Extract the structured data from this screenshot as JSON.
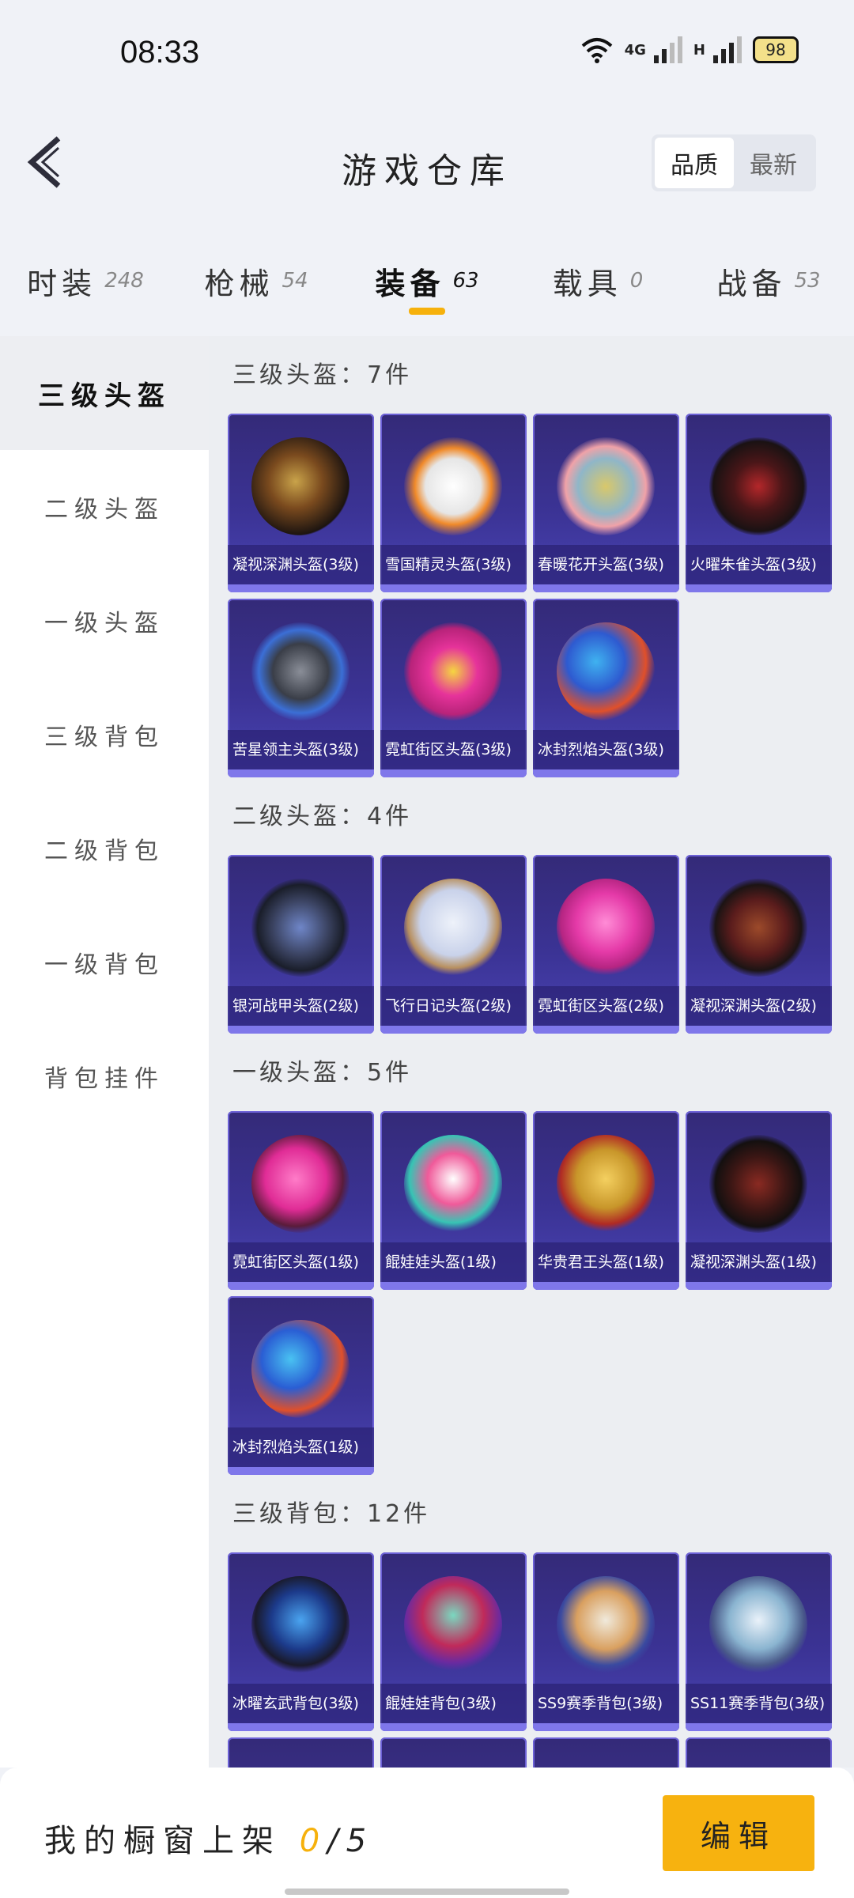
{
  "status": {
    "time": "08:33",
    "network": "4G",
    "network2": "H",
    "battery": "98"
  },
  "header": {
    "title": "游戏仓库",
    "sort_quality": "品质",
    "sort_newest": "最新"
  },
  "tabs": [
    {
      "label": "时装",
      "count": "248"
    },
    {
      "label": "枪械",
      "count": "54"
    },
    {
      "label": "装备",
      "count": "63"
    },
    {
      "label": "载具",
      "count": "0"
    },
    {
      "label": "战备",
      "count": "53"
    }
  ],
  "sidebar": {
    "items": [
      "三级头盔",
      "二级头盔",
      "一级头盔",
      "三级背包",
      "二级背包",
      "一级背包",
      "背包挂件"
    ]
  },
  "sections": [
    {
      "title": "三级头盔：7件",
      "items": [
        "凝视深渊头盔(3级)",
        "雪国精灵头盔(3级)",
        "春暖花开头盔(3级)",
        "火曜朱雀头盔(3级)",
        "苦星领主头盔(3级)",
        "霓虹街区头盔(3级)",
        "冰封烈焰头盔(3级)"
      ]
    },
    {
      "title": "二级头盔：4件",
      "items": [
        "银河战甲头盔(2级)",
        "飞行日记头盔(2级)",
        "霓虹街区头盔(2级)",
        "凝视深渊头盔(2级)"
      ]
    },
    {
      "title": "一级头盔：5件",
      "items": [
        "霓虹街区头盔(1级)",
        "餛娃娃头盔(1级)",
        "华贵君王头盔(1级)",
        "凝视深渊头盔(1级)",
        "冰封烈焰头盔(1级)"
      ]
    },
    {
      "title": "三级背包：12件",
      "items": [
        "冰曜玄武背包(3级)",
        "餛娃娃背包(3级)",
        "SS9赛季背包(3级)",
        "SS11赛季背包(3级)"
      ]
    }
  ],
  "bottom": {
    "label": "我的橱窗上架",
    "current": "0",
    "total": "/5",
    "edit": "编辑"
  },
  "colors": {
    "accent": "#f6b10c",
    "card_bg": "#3b3395"
  }
}
